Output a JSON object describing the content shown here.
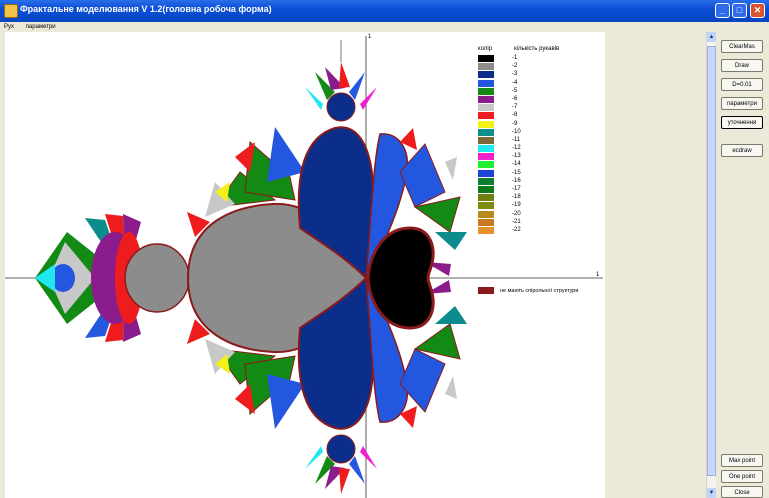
{
  "window": {
    "title": "Фрактальне моделювання  V 1.2(головна робоча форма)"
  },
  "window_controls": {
    "minimize": "_",
    "maximize": "□",
    "close": "✕"
  },
  "menu": [
    "Рух",
    "параметри"
  ],
  "axes": {
    "one_top": "1",
    "one_right": "1"
  },
  "legend": {
    "col1": "колір",
    "col2": "кількість рукавів",
    "items": [
      {
        "label": "-1",
        "color": "#000000"
      },
      {
        "label": "-2",
        "color": "#8C8C8C"
      },
      {
        "label": "-3",
        "color": "#0B2E8A"
      },
      {
        "label": "-4",
        "color": "#2457E0"
      },
      {
        "label": "-5",
        "color": "#138A13"
      },
      {
        "label": "-6",
        "color": "#8B1C8B"
      },
      {
        "label": "-7",
        "color": "#C8C8C8"
      },
      {
        "label": "-8",
        "color": "#EE1C1C"
      },
      {
        "label": "-9",
        "color": "#F6F01A"
      },
      {
        "label": "-10",
        "color": "#0C8C8C"
      },
      {
        "label": "-11",
        "color": "#7C6A3A"
      },
      {
        "label": "-12",
        "color": "#20E8F0"
      },
      {
        "label": "-13",
        "color": "#F020D0"
      },
      {
        "label": "-14",
        "color": "#20EE30"
      },
      {
        "label": "-15",
        "color": "#1E44D8"
      },
      {
        "label": "-16",
        "color": "#0E7E2E"
      },
      {
        "label": "-17",
        "color": "#0A7A18"
      },
      {
        "label": "-18",
        "color": "#6E7E12"
      },
      {
        "label": "-19",
        "color": "#7E8A10"
      },
      {
        "label": "-20",
        "color": "#B88A1A"
      },
      {
        "label": "-21",
        "color": "#C87A22"
      },
      {
        "label": "-22",
        "color": "#E8902A"
      }
    ],
    "footnote": {
      "label": "не мають спірольної структури",
      "color": "#8B1A1A"
    }
  },
  "buttons": {
    "clear": "ClearMas",
    "draw": "Draw",
    "d001": "D=0.01",
    "param": "параметри",
    "param2": "уточнення",
    "redraw": "ecdraw",
    "max_point": "Max point",
    "one_point": "One point",
    "close": "Close"
  },
  "scrollbar": {
    "up": "▲",
    "down": "▼"
  },
  "colors": {
    "titlebar": "#0A4FD6",
    "boundary": "#8B1A1A"
  }
}
